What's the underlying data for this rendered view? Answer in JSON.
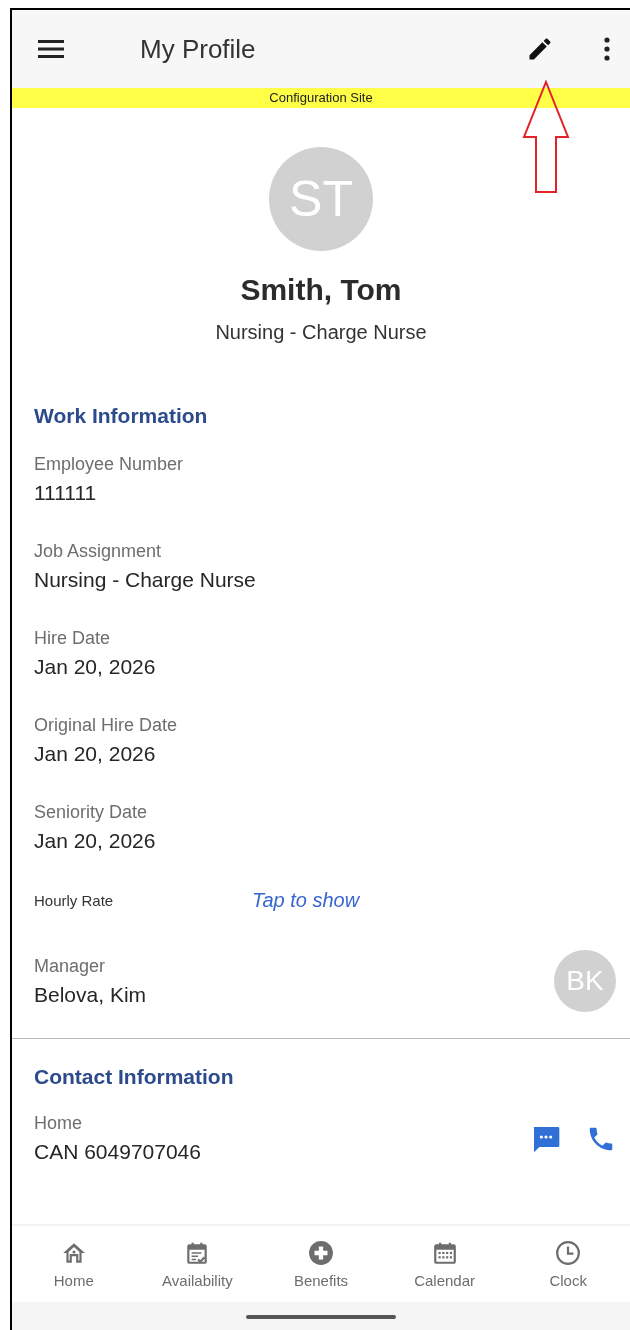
{
  "app_bar": {
    "title": "My Profile"
  },
  "banner": "Configuration Site",
  "profile": {
    "initials": "ST",
    "name": "Smith, Tom",
    "position": "Nursing - Charge Nurse"
  },
  "work_information": {
    "heading": "Work Information",
    "fields": [
      {
        "label": "Employee Number",
        "value": "111111"
      },
      {
        "label": "Job Assignment",
        "value": "Nursing - Charge Nurse"
      },
      {
        "label": "Hire Date",
        "value": "Jan 20, 2026"
      },
      {
        "label": "Original Hire Date",
        "value": "Jan 20, 2026"
      },
      {
        "label": "Seniority Date",
        "value": "Jan 20, 2026"
      }
    ],
    "hourly_rate": {
      "label": "Hourly Rate",
      "action": "Tap to show"
    },
    "manager": {
      "label": "Manager",
      "value": "Belova, Kim",
      "initials": "BK"
    }
  },
  "contact_information": {
    "heading": "Contact Information",
    "entries": [
      {
        "label": "Home",
        "value": "CAN 6049707046"
      }
    ]
  },
  "bottom_nav": [
    {
      "label": "Home",
      "kind": "home",
      "selected": false
    },
    {
      "label": "Availability",
      "kind": "availability",
      "selected": false
    },
    {
      "label": "Benefits",
      "kind": "benefits",
      "selected": false
    },
    {
      "label": "Calendar",
      "kind": "calendar",
      "selected": false
    },
    {
      "label": "Clock",
      "kind": "clock",
      "selected": false
    }
  ]
}
